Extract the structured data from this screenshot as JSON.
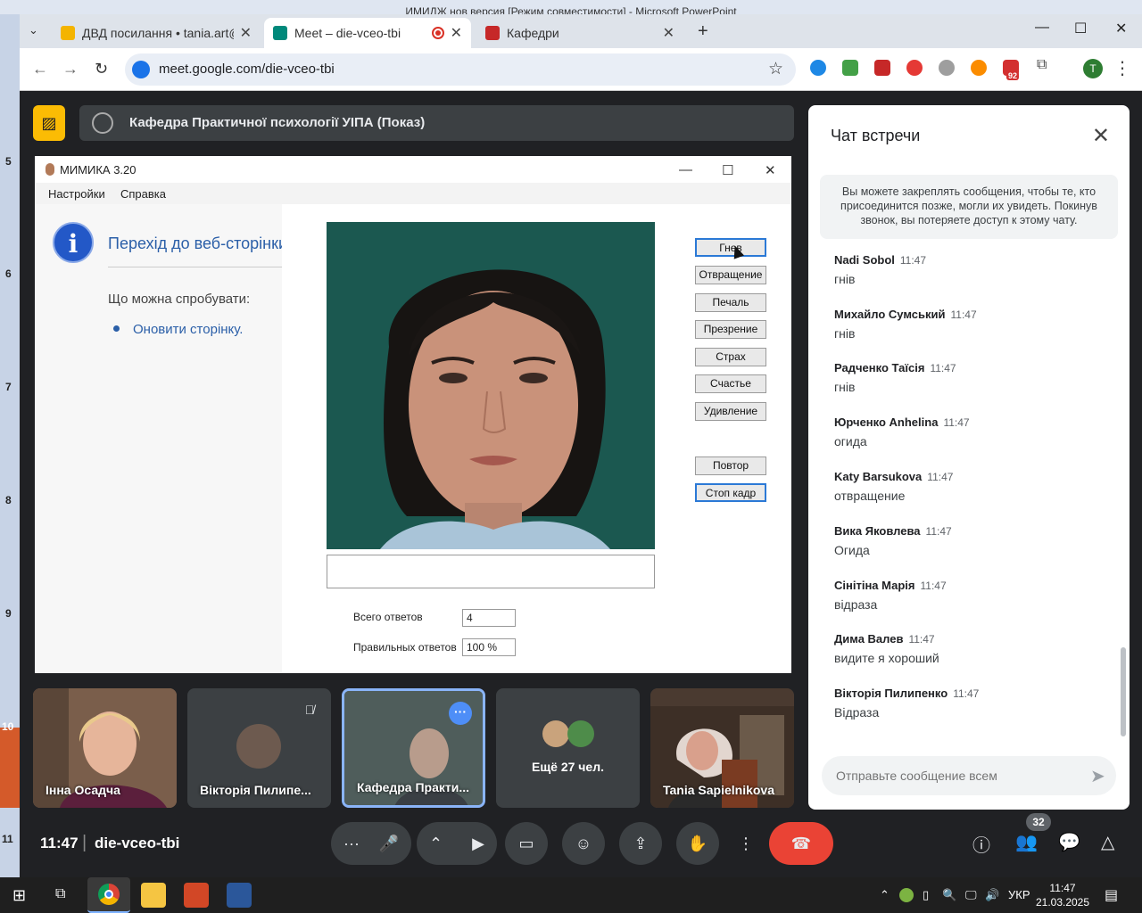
{
  "ppt": {
    "title": "ИМИДЖ нов версия [Режим совместимости] - Microsoft PowerPoint",
    "slide_numbers": [
      "5",
      "6",
      "7",
      "8",
      "9",
      "10",
      "11"
    ]
  },
  "browser": {
    "tabs": [
      {
        "title": "ДВД посилання • tania.art@uk",
        "favicon_color": "#f4b400"
      },
      {
        "title": "Meet – die-vceo-tbi",
        "favicon_color": "#00897b",
        "recording": true
      },
      {
        "title": "Кафедри",
        "favicon_color": "#c62828"
      }
    ],
    "url": "meet.google.com/die-vceo-tbi",
    "profile_initial": "T",
    "ext_badge": "92"
  },
  "presentation": {
    "title": "Кафедра Практичної психології УІПА (Показ)"
  },
  "mimika": {
    "title": "МИМИКА 3.20",
    "menu": [
      "Настройки",
      "Справка"
    ],
    "error_title": "Перехід до веб-сторінки неможливий",
    "error_try": "Що можна спробувати:",
    "error_link": "Оновити сторінку.",
    "buttons": [
      "Гнев",
      "Отвращение",
      "Печаль",
      "Презрение",
      "Страх",
      "Счастье",
      "Удивление"
    ],
    "btn_repeat": "Повтор",
    "btn_stop": "Стоп кадр",
    "total_label": "Всего ответов",
    "total_value": "4",
    "correct_label": "Правильных ответов",
    "correct_value": "100 %"
  },
  "participants": [
    {
      "name": "Інна Осадча"
    },
    {
      "name": "Вікторія Пилипе..."
    },
    {
      "name": "Кафедра Практи..."
    },
    {
      "name": "Ещё 27 чел."
    },
    {
      "name": "Tania Sapielnikova"
    }
  ],
  "chat": {
    "title": "Чат встречи",
    "note": "Вы можете закреплять сообщения, чтобы те, кто присоединится позже, могли их увидеть. Покинув звонок, вы потеряете доступ к этому чату.",
    "messages": [
      {
        "author": "Nadi Sobol",
        "time": "11:47",
        "text": "гнів"
      },
      {
        "author": "Михайло Сумський",
        "time": "11:47",
        "text": "гнів"
      },
      {
        "author": "Радченко Таїсія",
        "time": "11:47",
        "text": "гнів"
      },
      {
        "author": "Юрченко Anhelina",
        "time": "11:47",
        "text": "огида"
      },
      {
        "author": "Katy Barsukova",
        "time": "11:47",
        "text": "отвращение"
      },
      {
        "author": "Вика Яковлева",
        "time": "11:47",
        "text": "Огида"
      },
      {
        "author": "Сінітіна Марія",
        "time": "11:47",
        "text": "відраза"
      },
      {
        "author": "Дима Валев",
        "time": "11:47",
        "text": "видите я хороший"
      },
      {
        "author": "Вікторія Пилипенко",
        "time": "11:47",
        "text": "Відраза"
      }
    ],
    "input_placeholder": "Отправьте сообщение всем"
  },
  "meeting_bar": {
    "time": "11:47",
    "code": "die-vceo-tbi",
    "people_count": "32"
  },
  "taskbar": {
    "lang": "УКР",
    "time": "11:47",
    "date": "21.03.2025"
  }
}
